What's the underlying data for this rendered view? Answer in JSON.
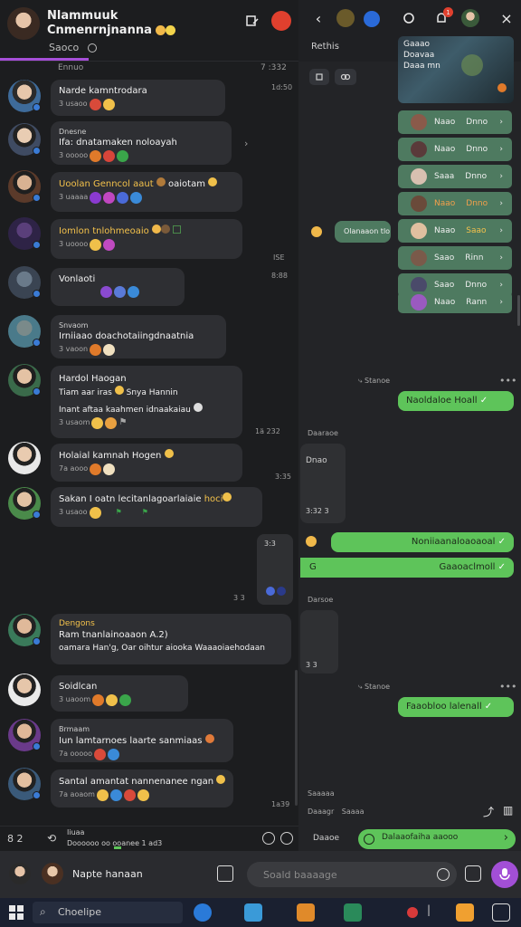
{
  "left_header": {
    "title_line1": "Nlammuuk",
    "title_line2": "Cnmenrnjnanna",
    "subtitle": "Saoco",
    "pinned_time_left": "Ennuo",
    "pinned_time_right": "7 :332"
  },
  "messages": [
    {
      "text": "Narde kamntrodara",
      "meta": "3 usaoo",
      "time": "1d:50"
    },
    {
      "name": "Dnesne",
      "text": "Ifa: dnatamaken noloayah",
      "meta": "3 ooooo",
      "time": ""
    },
    {
      "text": "Uoolan Genncol aaut",
      "text2": "oaiotam",
      "meta": "3 uaaaa",
      "time": ""
    },
    {
      "text": "Iomlon tnlohmeoaio",
      "meta": "3 uoooo",
      "time": "ISE"
    },
    {
      "text": "Vonlaoti",
      "meta": "",
      "time": "8:88"
    },
    {
      "name": "Snvaom",
      "text": "Irniiaao doachotaiingdnaatnia",
      "meta": "3 vaoon",
      "time": ""
    },
    {
      "text": "Hardol Haogan",
      "text2": "Tiam aar iras",
      "text3": "Snya Hannin",
      "text4": "Inant aftaa kaahmen idnaakaiau",
      "meta": "3 usaom",
      "time": "1ä 232"
    },
    {
      "text": "Holaial kamnah Hogen",
      "meta": "7a aooo",
      "time": "3:35"
    },
    {
      "text": "Sakan I oatn lecitanlagoarlaiaie",
      "text2": "hoci",
      "meta": "3 usaoo",
      "time": ""
    },
    {
      "name": "Dengons",
      "text": "Ram tnanlainoaaon A.2)",
      "text2": "oamara Han'g, Oar oihtur aiooka Waaaoiaehodaan",
      "meta": "",
      "time": ""
    },
    {
      "text": "Soidlcan",
      "meta": "3 uaoom",
      "time": ""
    },
    {
      "name": "Brmaam",
      "text": "Iun lamtarnoes laarte sanmiaas",
      "meta": "7a ooooo",
      "time": ""
    },
    {
      "text": "Santal amantat nannenanee ngan",
      "meta": "7a aoaom",
      "time": "1a39"
    }
  ],
  "left_footer": {
    "left": "8 2",
    "label": "Iiuaa",
    "label2": "Doooooo oo ooanee 1 ad3"
  },
  "right_header": {
    "title": "Rethis",
    "notif_count": "1"
  },
  "map_card": {
    "line1": "Gaaao",
    "line2": "Doavaa",
    "line3": "Daaa mn"
  },
  "members": [
    {
      "name": "Naao",
      "status": "Dnno"
    },
    {
      "name": "Naao",
      "status": "Dnno"
    },
    {
      "name": "Saaa",
      "status": "Dnno"
    },
    {
      "name": "Naao",
      "status": "Dnno"
    },
    {
      "name": "Naao",
      "status": "Saao"
    },
    {
      "name": "Saao",
      "status": "Rinn"
    },
    {
      "name": "Saao",
      "status": "Dnno"
    },
    {
      "name": "Naao",
      "status": "Rann"
    }
  ],
  "right_messages": {
    "r1": "Olanaaon tlo",
    "status1": "Stanoe",
    "g1": "Naoldaloe Hoall",
    "label_a": "Daaraoe",
    "dark1": "Dnao",
    "dark1_time": "3:32 3",
    "g2": "Noniiaanaloaoaoal",
    "g3": "Gaaoaclmoll",
    "label_b": "Darsoe",
    "status2": "Stanoe",
    "g4": "Faaobloo lalenall",
    "label_c": "Saaaaa",
    "label_d": "Daaagr",
    "label_e": "Saaaa",
    "footer_label": "Daaoe",
    "send_text": "Dalaaofaiha aaooo"
  },
  "compose": {
    "contact_name": "Napte hanaan",
    "placeholder": "Soald baaaage"
  },
  "taskbar": {
    "search_text": "Choelipe"
  }
}
